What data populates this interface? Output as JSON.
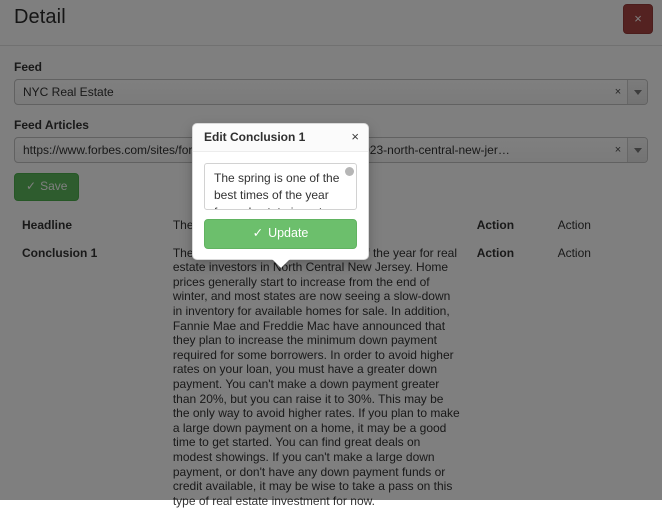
{
  "header": {
    "title": "Detail",
    "close_label": "×"
  },
  "form": {
    "feed_label": "Feed",
    "feed_value": "NYC Real Estate",
    "feed_clear": "×",
    "feed_articles_label": "Feed Articles",
    "feed_article_value": "https://www.forbes.com/sites/forbes-...trends-will-influence-the-2023-north-central-new-jer…",
    "feed_article_clear": "×",
    "save_label": "Save",
    "save_check": "✓"
  },
  "table": {
    "rows": [
      {
        "label": "Headline",
        "value": "These ...... Central New J...",
        "action_primary": "Action",
        "action_secondary": "Action"
      },
      {
        "label": "Conclusion 1",
        "value": "The spring is one of the best times of the year for real estate investors in North Central New Jersey. Home prices generally start to increase from the end of winter, and most states are now seeing a slow-down in inventory for available homes for sale. In addition, Fannie Mae and Freddie Mac have announced that they plan to increase the minimum down payment required for some borrowers. In order to avoid higher rates on your loan, you must have a greater down payment. You can't make a down payment greater than 20%, but you can raise it to 30%. This may be the only way to avoid higher rates. If you plan to make a large down payment on a home, it may be a good time to get started. You can find great deals on modest showings. If you can't make a large down payment, or don't have any down payment funds or credit available, it may be wise to take a pass on this type of real estate investment for now.",
        "action_primary": "Action",
        "action_secondary": "Action"
      }
    ]
  },
  "popover": {
    "title": "Edit Conclusion 1",
    "close_label": "×",
    "textarea_value": "The spring is one of the best times of the year for real estate investors in North Central New Jersey.",
    "textarea_placeholder": "",
    "update_label": "Update",
    "update_check": "✓"
  },
  "colors": {
    "danger": "#a94442",
    "success": "#5cb85c",
    "success_light": "#6cbf6c",
    "overlay": "#808080"
  }
}
